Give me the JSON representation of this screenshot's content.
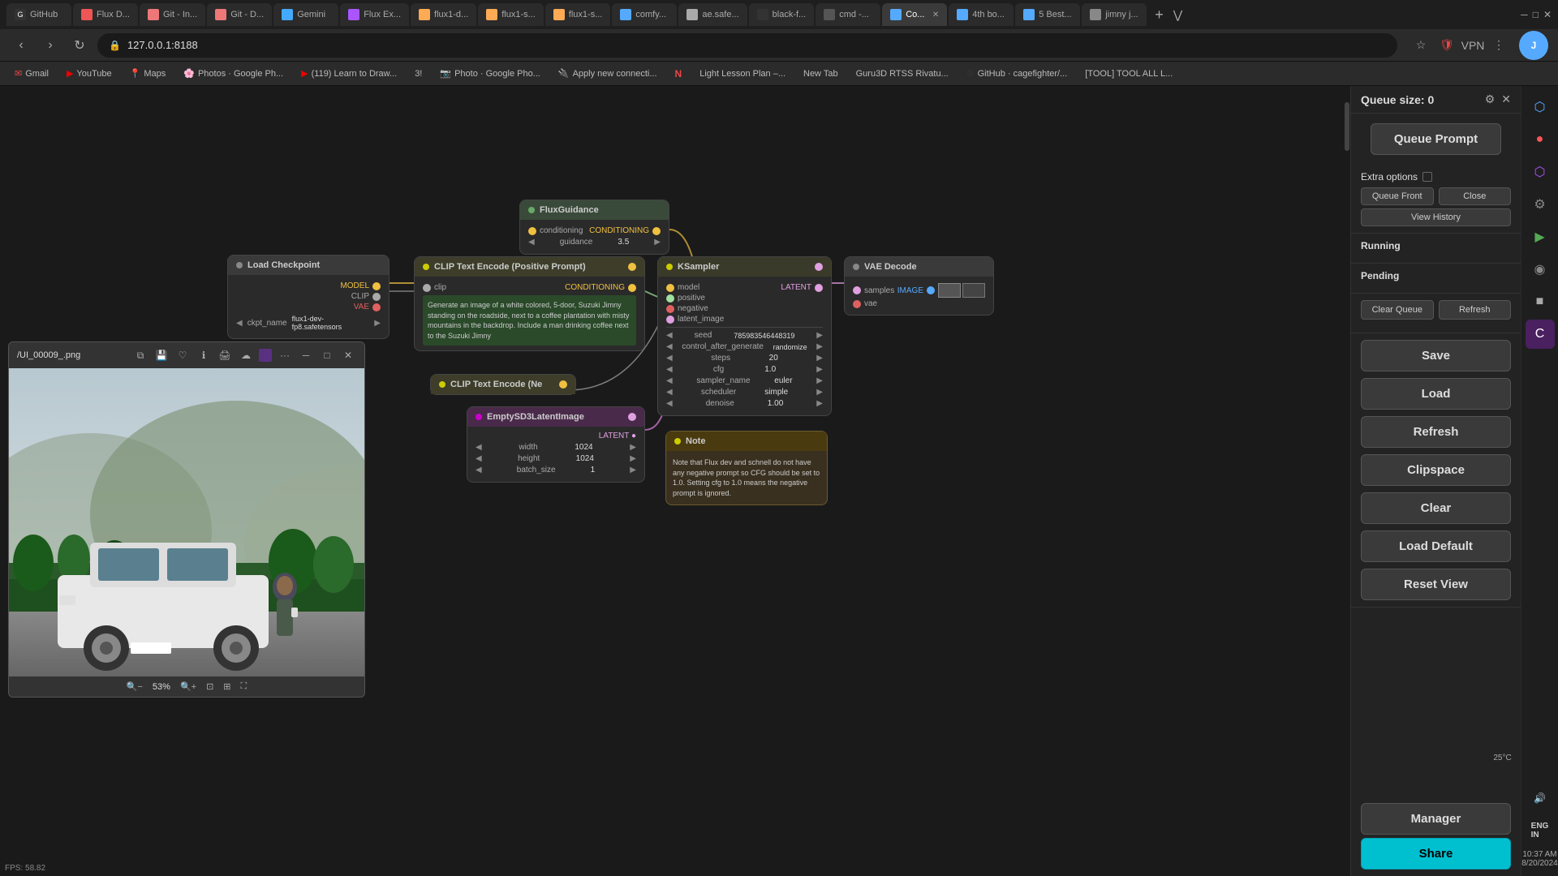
{
  "browser": {
    "tabs": [
      {
        "id": "github",
        "label": "GitHub",
        "favicon_color": "#333",
        "active": false
      },
      {
        "id": "flux-dev",
        "label": "Flux D...",
        "favicon_color": "#e55",
        "active": false
      },
      {
        "id": "git-in",
        "label": "Git - In...",
        "favicon_color": "#e77",
        "active": false
      },
      {
        "id": "git-da",
        "label": "Git - D...",
        "favicon_color": "#e77",
        "active": false
      },
      {
        "id": "gemini",
        "label": "Gemini",
        "favicon_color": "#4af",
        "active": false
      },
      {
        "id": "flux-ex",
        "label": "Flux Ex...",
        "favicon_color": "#a5f",
        "active": false
      },
      {
        "id": "flux1-d",
        "label": "flux1-d...",
        "favicon_color": "#fa5",
        "active": false
      },
      {
        "id": "flux1-s",
        "label": "flux1-s...",
        "favicon_color": "#fa5",
        "active": false
      },
      {
        "id": "flux1-b",
        "label": "flux1-s...",
        "favicon_color": "#fa5",
        "active": false
      },
      {
        "id": "comfy",
        "label": "comfy...",
        "favicon_color": "#5af",
        "active": false
      },
      {
        "id": "aesafe",
        "label": "ae.safe...",
        "favicon_color": "#aaa",
        "active": false
      },
      {
        "id": "black-f",
        "label": "black-f...",
        "favicon_color": "#aaa",
        "active": false
      },
      {
        "id": "cmd",
        "label": "cmd -...",
        "favicon_color": "#aaa",
        "active": false
      },
      {
        "id": "co-active",
        "label": "Co...",
        "favicon_color": "#5af",
        "active": true
      },
      {
        "id": "4th-bo",
        "label": "4th bo...",
        "favicon_color": "#5af",
        "active": false
      },
      {
        "id": "5best",
        "label": "5 Best...",
        "favicon_color": "#5af",
        "active": false
      },
      {
        "id": "jimny",
        "label": "jimny j...",
        "favicon_color": "#aaa",
        "active": false
      }
    ],
    "url": "127.0.0.1:8188",
    "bookmarks": [
      {
        "label": "Gmail",
        "favicon_color": "#e44"
      },
      {
        "label": "YouTube",
        "favicon_color": "#e00"
      },
      {
        "label": "Maps",
        "favicon_color": "#4a4"
      },
      {
        "label": "Photos · Google Ph...",
        "favicon_color": "#aaf"
      },
      {
        "label": "(119) Learn to Draw...",
        "favicon_color": "#e00"
      },
      {
        "label": "3!",
        "favicon_color": "#888"
      },
      {
        "label": "Photo · Google Pho...",
        "favicon_color": "#aaf"
      },
      {
        "label": "Apply new connecti...",
        "favicon_color": "#4a4"
      },
      {
        "label": "N",
        "favicon_color": "#e44"
      },
      {
        "label": "Light Lesson Plan –...",
        "favicon_color": "#4af"
      },
      {
        "label": "New Tab",
        "favicon_color": "#888"
      },
      {
        "label": "Guru3D RTSS Rivatu...",
        "favicon_color": "#aaa"
      },
      {
        "label": "GitHub · cagefighter/...",
        "favicon_color": "#333"
      },
      {
        "label": "[TOOL] TOOL ALL L...",
        "favicon_color": "#aaa"
      }
    ]
  },
  "canvas": {
    "fps": "FPS: 58.82"
  },
  "nodes": {
    "flux_guidance": {
      "title": "FluxGuidance",
      "inputs": [
        {
          "label": "conditioning",
          "value": "CONDITIONING"
        }
      ],
      "params": [
        {
          "label": "guidance",
          "value": "3.5"
        }
      ]
    },
    "load_checkpoint": {
      "title": "Load Checkpoint",
      "ports": [
        "MODEL",
        "CLIP",
        "VAE"
      ],
      "params": [
        {
          "label": "ckpt_name",
          "value": "flux1-dev-fp8.safetensors"
        }
      ]
    },
    "clip_text_pos": {
      "title": "CLIP Text Encode (Positive Prompt)",
      "ports_in": [
        "clip"
      ],
      "ports_out": [
        "CONDITIONING"
      ],
      "text": "Generate an image of a white colored, 5-door, Suzuki Jimny standing on the roadside, next to a coffee plantation with misty mountains in the backdrop. Include a man drinking coffee next to the Suzuki Jimny"
    },
    "ksampler": {
      "title": "KSampler",
      "ports_in": [
        "model",
        "positive",
        "negative",
        "latent_image"
      ],
      "ports_out": [
        "LATENT"
      ],
      "params": [
        {
          "label": "seed",
          "value": "785983546448319"
        },
        {
          "label": "control_after_generate",
          "value": "randomize"
        },
        {
          "label": "steps",
          "value": "20"
        },
        {
          "label": "cfg",
          "value": "1.0"
        },
        {
          "label": "sampler_name",
          "value": "euler"
        },
        {
          "label": "scheduler",
          "value": "simple"
        },
        {
          "label": "denoise",
          "value": "1.00"
        }
      ]
    },
    "vae_decode": {
      "title": "VAE Decode",
      "ports_in": [
        "samples",
        "vae"
      ],
      "ports_out": [
        "IMAGE"
      ]
    },
    "clip_text_neg": {
      "title": "CLIP Text Encode (Ne"
    },
    "empty_latent": {
      "title": "EmptySD3LatentImage",
      "ports_out": [
        "LATENT"
      ],
      "params": [
        {
          "label": "width",
          "value": "1024"
        },
        {
          "label": "height",
          "value": "1024"
        },
        {
          "label": "batch_size",
          "value": "1"
        }
      ]
    },
    "note": {
      "title": "Note",
      "content": "Note that Flux dev and schnell do not have any negative prompt so CFG should be set to 1.0. Setting cfg to 1.0 means the negative prompt is ignored."
    }
  },
  "image_viewer": {
    "title": "/UI_00009_.png",
    "zoom": "53%"
  },
  "right_panel": {
    "queue_size_label": "Queue size: 0",
    "queue_prompt_label": "Queue Prompt",
    "extra_options_label": "Extra options",
    "queue_front_label": "Queue Front",
    "close_label": "Close",
    "view_history_label": "View History",
    "running_label": "Running",
    "pending_label": "Pending",
    "clear_queue_label": "Clear Queue",
    "refresh_label": "Refresh",
    "save_label": "Save",
    "load_label": "Load",
    "refresh_btn_label": "Refresh",
    "clipspace_label": "Clipspace",
    "clear_label": "Clear",
    "load_default_label": "Load Default",
    "reset_view_label": "Reset View",
    "manager_label": "Manager",
    "share_label": "Share"
  },
  "temperature": {
    "value": "25°C"
  },
  "time": {
    "value": "10:37 AM",
    "date": "8/20/2024"
  }
}
